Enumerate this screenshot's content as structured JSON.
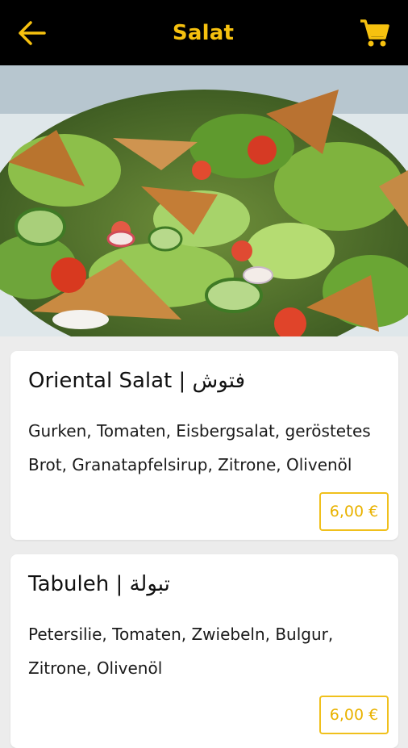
{
  "header": {
    "title": "Salat",
    "back_icon": "arrow-left-icon",
    "cart_icon": "shopping-cart-icon",
    "accent": "#f6c10f"
  },
  "hero": {
    "image": "salad-photo"
  },
  "items": [
    {
      "name": "Oriental Salat | فتوش",
      "description": "Gurken, Tomaten, Eisbergsalat, geröstetes Brot, Granatapfelsirup, Zitrone, Olivenöl",
      "price": "6,00 €"
    },
    {
      "name": "Tabuleh | تبولة",
      "description": "Petersilie, Tomaten, Zwiebeln, Bulgur, Zitrone, Olivenöl",
      "price": "6,00 €"
    }
  ]
}
